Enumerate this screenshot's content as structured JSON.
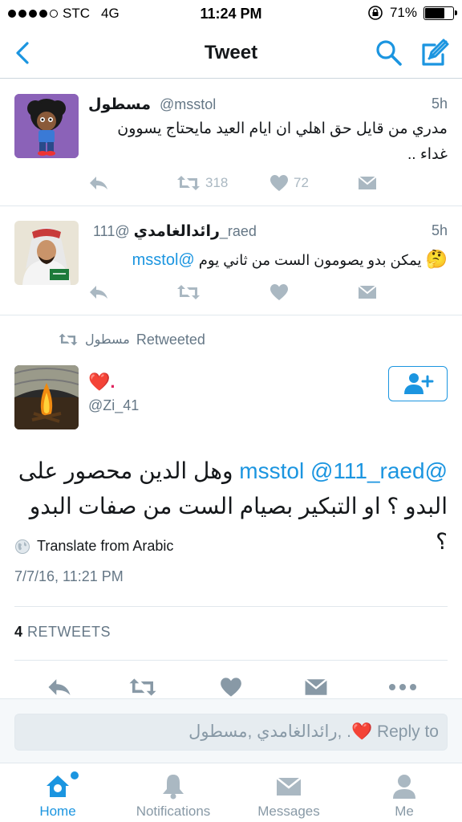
{
  "status_bar": {
    "carrier": "STC",
    "network": "4G",
    "time": "11:24 PM",
    "battery": "71%",
    "battery_level": 0.71
  },
  "nav": {
    "title": "Tweet",
    "back_icon": "chevron-left-icon",
    "search_icon": "search-icon",
    "compose_icon": "compose-icon"
  },
  "tweets": [
    {
      "name": "مسطول",
      "handle": "@msstol",
      "time": "5h",
      "text_line1": "مدري من قايل حق اهلي ان ايام العيد مايحتاج يسوون",
      "text_line2": "غداء ..",
      "retweets": "318",
      "likes": "72"
    },
    {
      "name": "رائدالغامدي",
      "handle": "@111_raed",
      "time": "5h",
      "mention": "@msstol",
      "text": "يمكن بدو يصومون الست من ثاني يوم",
      "emoji": "🤔"
    }
  ],
  "retweet_context": {
    "by": "مسطول",
    "label": "Retweeted"
  },
  "main_tweet": {
    "name": "❤️.",
    "handle": "@Zi_41",
    "mention1": "@111_raed",
    "mention2": "@msstol",
    "text_line1_end": "وهل الدين محصور على",
    "text_line2": "البدو ؟ او التبكير بصيام الست من صفات البدو ؟",
    "translate": "Translate from Arabic",
    "timestamp": "7/7/16, 11:21 PM",
    "retweet_count": "4",
    "retweet_label": "RETWEETS"
  },
  "reply": {
    "placeholder": "Reply to ❤️. ,رائدالغامدي ,مسطول"
  },
  "tabs": [
    {
      "label": "Home",
      "icon": "home-icon",
      "active": true
    },
    {
      "label": "Notifications",
      "icon": "bell-icon",
      "active": false
    },
    {
      "label": "Messages",
      "icon": "envelope-icon",
      "active": false
    },
    {
      "label": "Me",
      "icon": "person-icon",
      "active": false
    }
  ],
  "colors": {
    "accent": "#1b95e0",
    "muted": "#aab8c2",
    "text": "#14171a"
  }
}
